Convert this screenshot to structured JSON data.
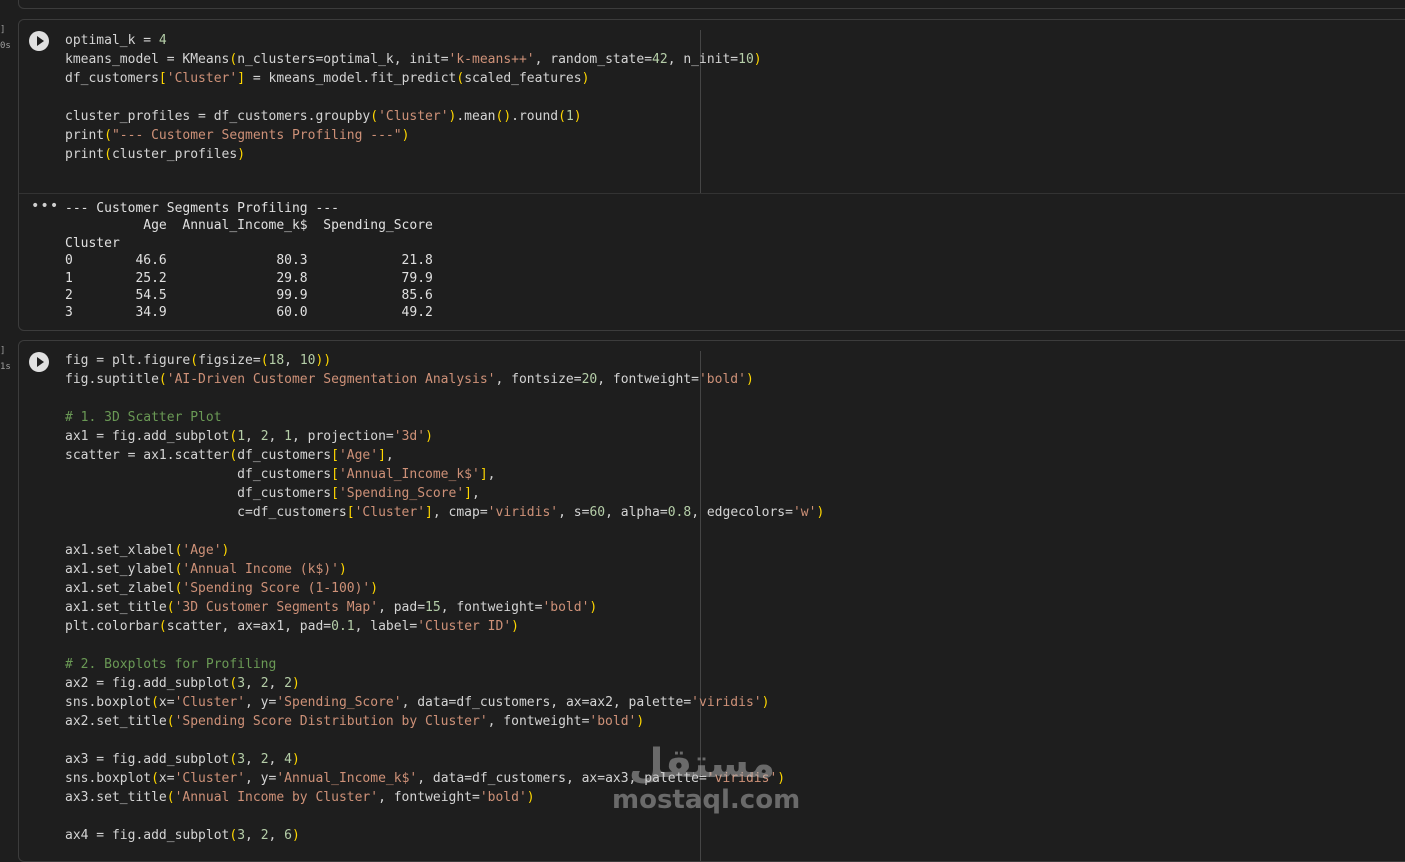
{
  "theme": {
    "background": "#1e1e1e",
    "text": "#d4d4d4",
    "string": "#ce9178",
    "number": "#b5cea8",
    "comment": "#6a9955",
    "border": "#3c3c3c"
  },
  "icons": {
    "run": "play-circle-icon",
    "output_menu": "more-horizontal-icon"
  },
  "gutter": {
    "cell1_exec_count": "]",
    "cell1_time": "0s",
    "cell2_exec_count": "]",
    "cell2_time": "1s"
  },
  "cells": [
    {
      "lines": [
        "optimal_k = 4",
        "kmeans_model = KMeans(n_clusters=optimal_k, init='k-means++', random_state=42, n_init=10)",
        "df_customers['Cluster'] = kmeans_model.fit_predict(scaled_features)",
        "",
        "cluster_profiles = df_customers.groupby('Cluster').mean().round(1)",
        "print(\"--- Customer Segments Profiling ---\")",
        "print(cluster_profiles)"
      ],
      "output": [
        "--- Customer Segments Profiling ---",
        "          Age  Annual_Income_k$  Spending_Score",
        "Cluster",
        "0        46.6              80.3            21.8",
        "1        25.2              29.8            79.9",
        "2        54.5              99.9            85.6",
        "3        34.9              60.0            49.2"
      ]
    },
    {
      "lines": [
        "fig = plt.figure(figsize=(18, 10))",
        "fig.suptitle('AI-Driven Customer Segmentation Analysis', fontsize=20, fontweight='bold')",
        "",
        "# 1. 3D Scatter Plot",
        "ax1 = fig.add_subplot(1, 2, 1, projection='3d')",
        "scatter = ax1.scatter(df_customers['Age'],",
        "                      df_customers['Annual_Income_k$'],",
        "                      df_customers['Spending_Score'],",
        "                      c=df_customers['Cluster'], cmap='viridis', s=60, alpha=0.8, edgecolors='w')",
        "",
        "ax1.set_xlabel('Age')",
        "ax1.set_ylabel('Annual Income (k$)')",
        "ax1.set_zlabel('Spending Score (1-100)')",
        "ax1.set_title('3D Customer Segments Map', pad=15, fontweight='bold')",
        "plt.colorbar(scatter, ax=ax1, pad=0.1, label='Cluster ID')",
        "",
        "# 2. Boxplots for Profiling",
        "ax2 = fig.add_subplot(3, 2, 2)",
        "sns.boxplot(x='Cluster', y='Spending_Score', data=df_customers, ax=ax2, palette='viridis')",
        "ax2.set_title('Spending Score Distribution by Cluster', fontweight='bold')",
        "",
        "ax3 = fig.add_subplot(3, 2, 4)",
        "sns.boxplot(x='Cluster', y='Annual_Income_k$', data=df_customers, ax=ax3, palette='viridis')",
        "ax3.set_title('Annual Income by Cluster', fontweight='bold')",
        "",
        "ax4 = fig.add_subplot(3, 2, 6)"
      ]
    }
  ],
  "watermark": {
    "arabic": "مستقل",
    "latin": "mostaql.com"
  }
}
